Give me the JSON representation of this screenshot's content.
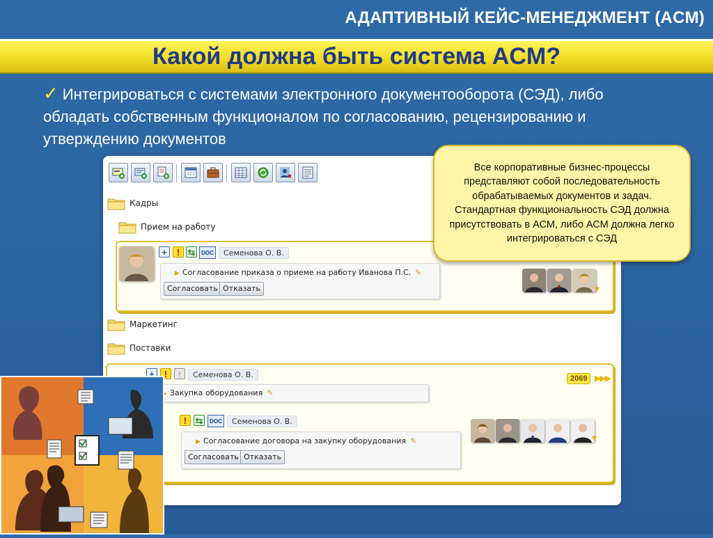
{
  "header": {
    "title": "АДАПТИВНЫЙ КЕЙС-МЕНЕДЖМЕНТ (ACM)"
  },
  "slide": {
    "main_title": "Какой должна быть система ACM?",
    "bullet_text": "Интегрироваться с системами электронного документооборота (СЭД), либо обладать собственным функционалом по согласованию, рецензированию и утверждению документов",
    "callout_text": "Все корпоративные бизнес-процессы представляют собой последовательность обрабатываемых документов и задач. Стандартная функциональность СЭД должна присутствовать в АСМ, либо АСМ должна легко интегрироваться с СЭД"
  },
  "app": {
    "folders": {
      "kadry": "Кадры",
      "priem": "Прием на работу",
      "marketing": "Маркетинг",
      "postavki": "Поставки"
    },
    "doc_label": "DOC",
    "card1": {
      "assignee": "Семенова О. В.",
      "task_title": "Согласование приказа о приеме на работу Иванова П.С.",
      "approve_label": "Согласовать",
      "reject_label": "Отказать"
    },
    "card2": {
      "assignee": "Семенова О. В.",
      "badge": "2069",
      "task_title": "Закупка оборудования",
      "sub_assignee": "Семенова О. В.",
      "sub_task_title": "Согласование договора на закупку оборудования",
      "approve_label": "Согласовать",
      "reject_label": "Отказать"
    }
  },
  "colors": {
    "background": "#2b62a0",
    "title_bar": "#f2de27",
    "title_text": "#1f3a86",
    "check": "#ffe92a",
    "card_border": "#e2bf2a",
    "callout_bg": "#fff5a8"
  }
}
